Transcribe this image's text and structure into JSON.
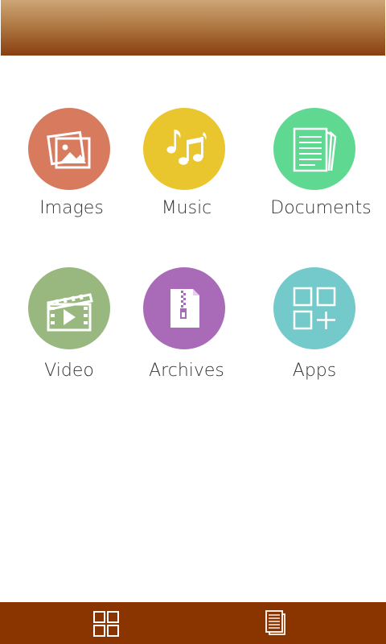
{
  "colors": {
    "header_top": "#cda576",
    "header_bottom": "#8a3f10",
    "tabbar": "#8a3500",
    "images": "#d77a5e",
    "music": "#eac62e",
    "documents": "#5fd991",
    "video": "#98b87f",
    "archives": "#a96bb8",
    "apps": "#74cacb"
  },
  "categories": [
    {
      "label": "Images",
      "icon": "images-icon"
    },
    {
      "label": "Music",
      "icon": "music-icon"
    },
    {
      "label": "Documents",
      "icon": "documents-icon"
    },
    {
      "label": "Video",
      "icon": "video-icon"
    },
    {
      "label": "Archives",
      "icon": "archives-icon"
    },
    {
      "label": "Apps",
      "icon": "apps-icon"
    }
  ],
  "tabs": [
    {
      "icon": "grid-icon"
    },
    {
      "icon": "document-list-icon"
    }
  ]
}
